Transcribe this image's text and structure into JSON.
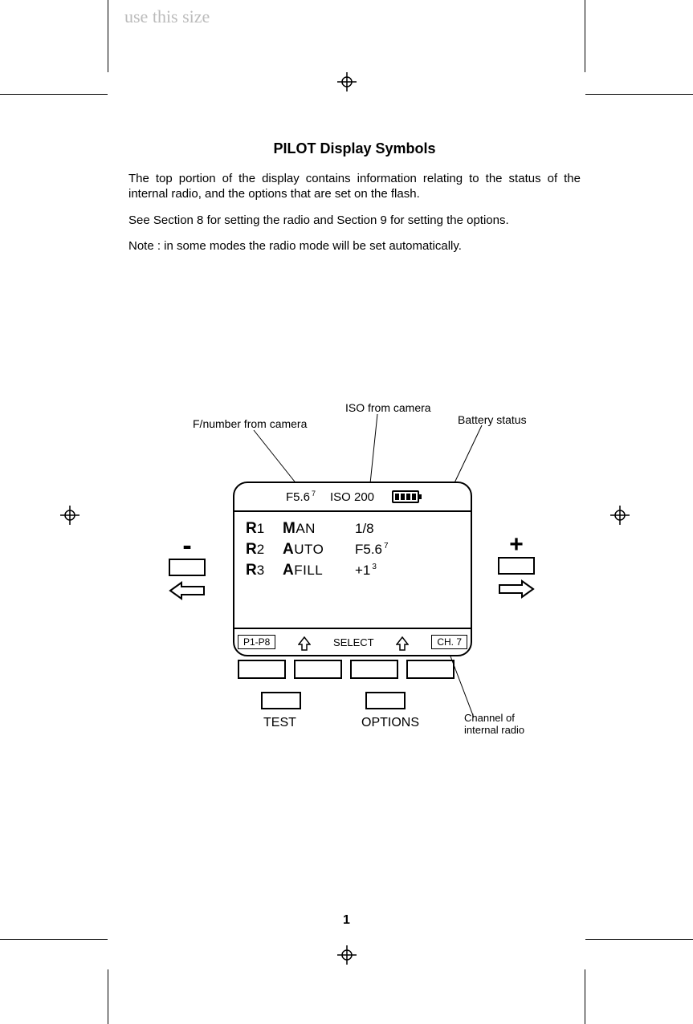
{
  "watermark": "use this size",
  "title": "PILOT Display Symbols",
  "para1": "The top portion of the display contains information relating to the status of the internal radio, and the options that are set on the flash.",
  "para2": "See Section 8 for setting the radio and Section 9 for setting the options.",
  "para3": "Note : in some modes the radio mode will be set automatically.",
  "callouts": {
    "fnumber": "F/number from camera",
    "iso": "ISO from camera",
    "battery": "Battery status",
    "channel_l1": "Channel of",
    "channel_l2": "internal radio"
  },
  "lcd": {
    "fnumber": "F5.6",
    "fnumber_sup": "7",
    "iso": "ISO 200",
    "rows": [
      {
        "r": "R",
        "rn": "1",
        "modeB": "M",
        "modeRest": "AN",
        "val": "1/8",
        "sup": ""
      },
      {
        "r": "R",
        "rn": "2",
        "modeB": "A",
        "modeRest": "UTO",
        "val": "F5.6",
        "sup": "7"
      },
      {
        "r": "R",
        "rn": "3",
        "modeB": "A",
        "modeRest": "FILL",
        "val": "+1",
        "sup": "3"
      }
    ],
    "bottom": {
      "left": "P1-P8",
      "mid": "SELECT",
      "right": "CH. 7"
    }
  },
  "sides": {
    "minus": "-",
    "plus": "+"
  },
  "labels": {
    "test": "TEST",
    "options": "OPTIONS"
  },
  "page": "1"
}
